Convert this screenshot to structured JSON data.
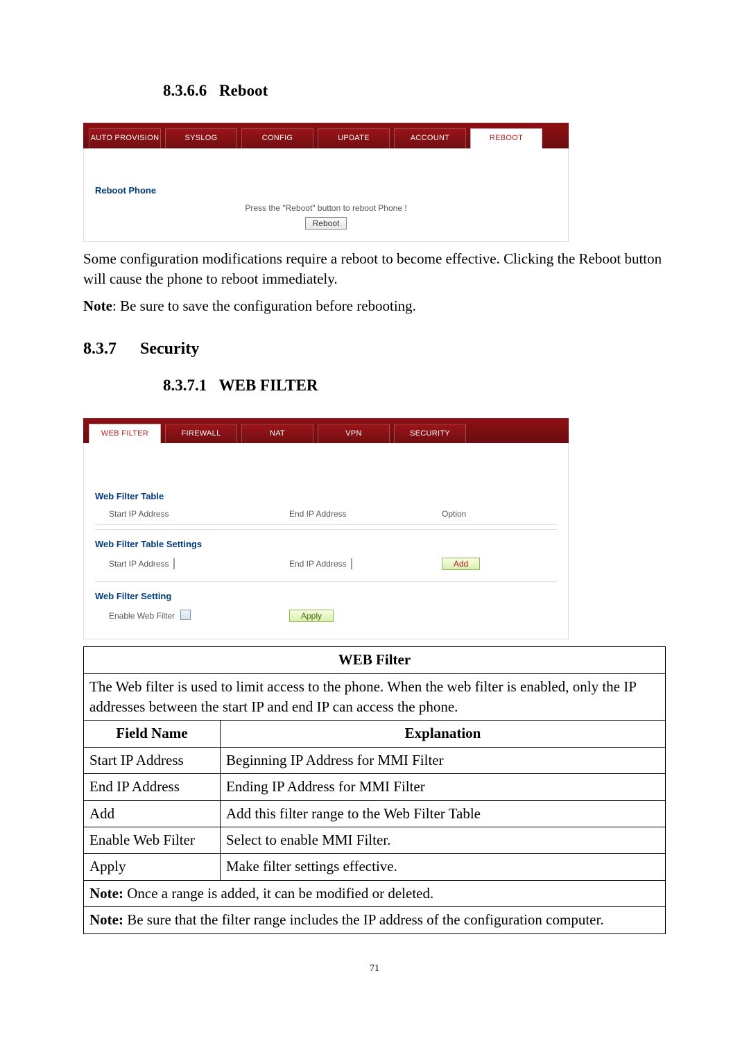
{
  "sections": {
    "reboot_num": "8.3.6.6",
    "reboot_title": "Reboot",
    "security_num": "8.3.7",
    "security_title": "Security",
    "webfilter_num": "8.3.7.1",
    "webfilter_title": "WEB FILTER"
  },
  "reboot_shot": {
    "tabs": [
      "AUTO PROVISION",
      "SYSLOG",
      "CONFIG",
      "UPDATE",
      "ACCOUNT",
      "REBOOT"
    ],
    "active_index": 5,
    "heading": "Reboot Phone",
    "instruction": "Press the \"Reboot\" button to reboot Phone !",
    "button": "Reboot"
  },
  "reboot_text": {
    "p1": "Some configuration modifications require a reboot to become effective.    Clicking the Reboot button will cause the phone to reboot immediately.",
    "note_label": "Note",
    "note_text": ": Be sure to save the configuration before rebooting."
  },
  "wf_shot": {
    "tabs": [
      "WEB FILTER",
      "FIREWALL",
      "NAT",
      "VPN",
      "SECURITY"
    ],
    "active_index": 0,
    "sec1": "Web Filter Table",
    "col_start": "Start IP Address",
    "col_end": "End IP Address",
    "col_opt": "Option",
    "sec2": "Web Filter Table Settings",
    "add_btn": "Add",
    "sec3": "Web Filter Setting",
    "enable_label": "Enable Web Filter",
    "apply_btn": "Apply"
  },
  "wf_table": {
    "title": "WEB Filter",
    "intro": "The Web filter is used to limit access to the phone.    When the web filter is enabled, only the IP addresses between the start IP and end IP can access the phone.",
    "head_field": "Field Name",
    "head_expl": "Explanation",
    "rows": [
      {
        "f": "Start IP Address",
        "e": "Beginning IP Address for MMI Filter"
      },
      {
        "f": "End IP Address",
        "e": "Ending IP Address for MMI Filter"
      },
      {
        "f": "Add",
        "e": "Add this filter range to the Web Filter Table"
      },
      {
        "f": "Enable Web Filter",
        "e": "Select to enable MMI Filter."
      },
      {
        "f": "Apply",
        "e": "Make filter settings effective."
      }
    ],
    "note1_label": "Note:",
    "note1_text": " Once a range is added, it can be modified or deleted.",
    "note2_label": "Note:",
    "note2_text": " Be sure that the filter range includes the IP address of the configuration computer."
  },
  "page_number": "71"
}
